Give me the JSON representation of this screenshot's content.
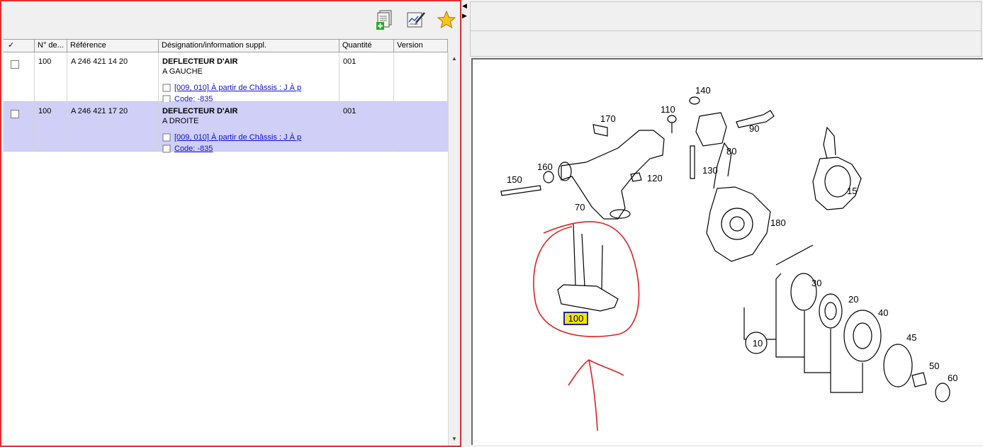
{
  "toolbar": {
    "buttons": [
      {
        "name": "add-to-list-icon"
      },
      {
        "name": "edit-notes-icon"
      },
      {
        "name": "favorites-star-icon"
      }
    ]
  },
  "grid": {
    "headers": {
      "check": "✓",
      "num": "N° de...",
      "ref": "Référence",
      "desig": "Désignation/information suppl.",
      "qty": "Quantité",
      "version": "Version"
    },
    "rows": [
      {
        "num": "100",
        "ref": "A 246 421 14 20",
        "title": "DEFLECTEUR D'AIR",
        "subtitle": "A GAUCHE",
        "note1": "[009, 010] À partir de Châssis : J À p",
        "note2": "Code: -835",
        "qty": "001",
        "version": ""
      },
      {
        "num": "100",
        "ref": "A 246 421 17 20",
        "title": "DEFLECTEUR D'AIR",
        "subtitle": "A DROITE",
        "note1": "[009, 010] À partir de Châssis : J À p",
        "note2": "Code: -835",
        "qty": "001",
        "version": ""
      }
    ]
  },
  "diagram": {
    "highlighted_label": "100",
    "highlight_color": "#f5e600",
    "annotation_color": "#e02020",
    "callouts": {
      "c10": "10",
      "c15": "15",
      "c20": "20",
      "c30": "30",
      "c40": "40",
      "c45": "45",
      "c50": "50",
      "c60": "60",
      "c70": "70",
      "c80": "80",
      "c90": "90",
      "c110": "110",
      "c120": "120",
      "c130": "130",
      "c140": "140",
      "c150": "150",
      "c160": "160",
      "c170": "170",
      "c180": "180"
    }
  },
  "colors": {
    "selected_row": "#cfcff8",
    "link": "#1010cc",
    "pane_border": "#e03030"
  }
}
